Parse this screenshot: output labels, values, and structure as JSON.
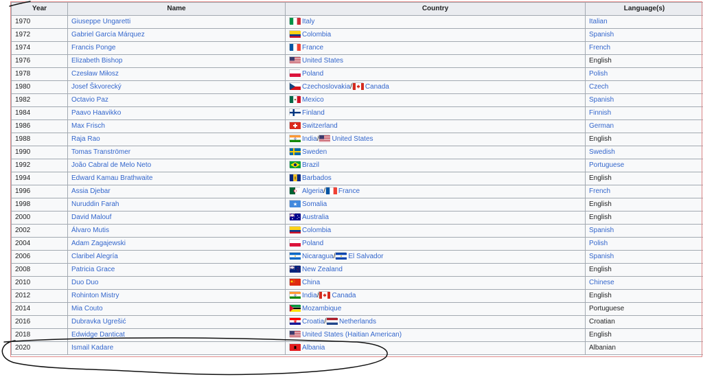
{
  "columns": [
    "Year",
    "Name",
    "Country",
    "Language(s)"
  ],
  "colors": {
    "link": "#3366cc",
    "header_bg": "#eaecf0",
    "cell_bg": "#f8f9fa",
    "border": "#a2a9b1"
  },
  "rows": [
    {
      "year": "1970",
      "name": "Giuseppe Ungaretti",
      "countries": [
        {
          "flag": "italy-flag",
          "label": "Italy"
        }
      ],
      "language": "Italian",
      "language_link": true
    },
    {
      "year": "1972",
      "name": "Gabriel García Márquez",
      "countries": [
        {
          "flag": "colombia-flag",
          "label": "Colombia"
        }
      ],
      "language": "Spanish",
      "language_link": true
    },
    {
      "year": "1974",
      "name": "Francis Ponge",
      "countries": [
        {
          "flag": "france-flag",
          "label": "France"
        }
      ],
      "language": "French",
      "language_link": true
    },
    {
      "year": "1976",
      "name": "Elizabeth Bishop",
      "countries": [
        {
          "flag": "usa-flag",
          "label": "United States"
        }
      ],
      "language": "English",
      "language_link": false
    },
    {
      "year": "1978",
      "name": "Czesław Miłosz",
      "countries": [
        {
          "flag": "poland-flag",
          "label": "Poland"
        }
      ],
      "language": "Polish",
      "language_link": true
    },
    {
      "year": "1980",
      "name": "Josef Škvorecký",
      "countries": [
        {
          "flag": "czechoslovakia-flag",
          "label": "Czechoslovakia"
        },
        {
          "flag": "canada-flag",
          "label": "Canada"
        }
      ],
      "language": "Czech",
      "language_link": true
    },
    {
      "year": "1982",
      "name": "Octavio Paz",
      "countries": [
        {
          "flag": "mexico-flag",
          "label": "Mexico"
        }
      ],
      "language": "Spanish",
      "language_link": true
    },
    {
      "year": "1984",
      "name": "Paavo Haavikko",
      "countries": [
        {
          "flag": "finland-flag",
          "label": "Finland"
        }
      ],
      "language": "Finnish",
      "language_link": true
    },
    {
      "year": "1986",
      "name": "Max Frisch",
      "countries": [
        {
          "flag": "switzerland-flag",
          "label": "Switzerland"
        }
      ],
      "language": "German",
      "language_link": true
    },
    {
      "year": "1988",
      "name": "Raja Rao",
      "countries": [
        {
          "flag": "india-flag",
          "label": "India"
        },
        {
          "flag": "usa-flag",
          "label": "United States"
        }
      ],
      "language": "English",
      "language_link": false
    },
    {
      "year": "1990",
      "name": "Tomas Tranströmer",
      "countries": [
        {
          "flag": "sweden-flag",
          "label": "Sweden"
        }
      ],
      "language": "Swedish",
      "language_link": true
    },
    {
      "year": "1992",
      "name": "João Cabral de Melo Neto",
      "countries": [
        {
          "flag": "brazil-flag",
          "label": "Brazil"
        }
      ],
      "language": "Portuguese",
      "language_link": true
    },
    {
      "year": "1994",
      "name": "Edward Kamau Brathwaite",
      "countries": [
        {
          "flag": "barbados-flag",
          "label": "Barbados"
        }
      ],
      "language": "English",
      "language_link": false
    },
    {
      "year": "1996",
      "name": "Assia Djebar",
      "countries": [
        {
          "flag": "algeria-flag",
          "label": "Algeria"
        },
        {
          "flag": "france-flag",
          "label": "France"
        }
      ],
      "language": "French",
      "language_link": true
    },
    {
      "year": "1998",
      "name": "Nuruddin Farah",
      "countries": [
        {
          "flag": "somalia-flag",
          "label": "Somalia"
        }
      ],
      "language": "English",
      "language_link": false
    },
    {
      "year": "2000",
      "name": "David Malouf",
      "countries": [
        {
          "flag": "australia-flag",
          "label": "Australia"
        }
      ],
      "language": "English",
      "language_link": false
    },
    {
      "year": "2002",
      "name": "Álvaro Mutis",
      "countries": [
        {
          "flag": "colombia-flag",
          "label": "Colombia"
        }
      ],
      "language": "Spanish",
      "language_link": true
    },
    {
      "year": "2004",
      "name": "Adam Zagajewski",
      "countries": [
        {
          "flag": "poland-flag",
          "label": "Poland"
        }
      ],
      "language": "Polish",
      "language_link": true
    },
    {
      "year": "2006",
      "name": "Claribel Alegría",
      "countries": [
        {
          "flag": "nicaragua-flag",
          "label": "Nicaragua"
        },
        {
          "flag": "el-salvador-flag",
          "label": "El Salvador"
        }
      ],
      "language": "Spanish",
      "language_link": true
    },
    {
      "year": "2008",
      "name": "Patricia Grace",
      "countries": [
        {
          "flag": "new-zealand-flag",
          "label": "New Zealand"
        }
      ],
      "language": "English",
      "language_link": false
    },
    {
      "year": "2010",
      "name": "Duo Duo",
      "countries": [
        {
          "flag": "china-flag",
          "label": "China"
        }
      ],
      "language": "Chinese",
      "language_link": true
    },
    {
      "year": "2012",
      "name": "Rohinton Mistry",
      "countries": [
        {
          "flag": "india-flag",
          "label": "India"
        },
        {
          "flag": "canada-flag",
          "label": "Canada"
        }
      ],
      "language": "English",
      "language_link": false
    },
    {
      "year": "2014",
      "name": "Mia Couto",
      "countries": [
        {
          "flag": "mozambique-flag",
          "label": "Mozambique"
        }
      ],
      "language": "Portuguese",
      "language_link": false
    },
    {
      "year": "2016",
      "name": "Dubravka Ugrešić",
      "countries": [
        {
          "flag": "croatia-flag",
          "label": "Croatia"
        },
        {
          "flag": "netherlands-flag",
          "label": "Netherlands"
        }
      ],
      "language": "Croatian",
      "language_link": false
    },
    {
      "year": "2018",
      "name": "Edwidge Danticat",
      "countries": [
        {
          "flag": "usa-flag",
          "label": "United States (Haitian American)"
        }
      ],
      "language": "English",
      "language_link": false
    },
    {
      "year": "2020",
      "name": "Ismail Kadare",
      "countries": [
        {
          "flag": "albania-flag",
          "label": "Albania"
        }
      ],
      "language": "Albanian",
      "language_link": false
    }
  ]
}
